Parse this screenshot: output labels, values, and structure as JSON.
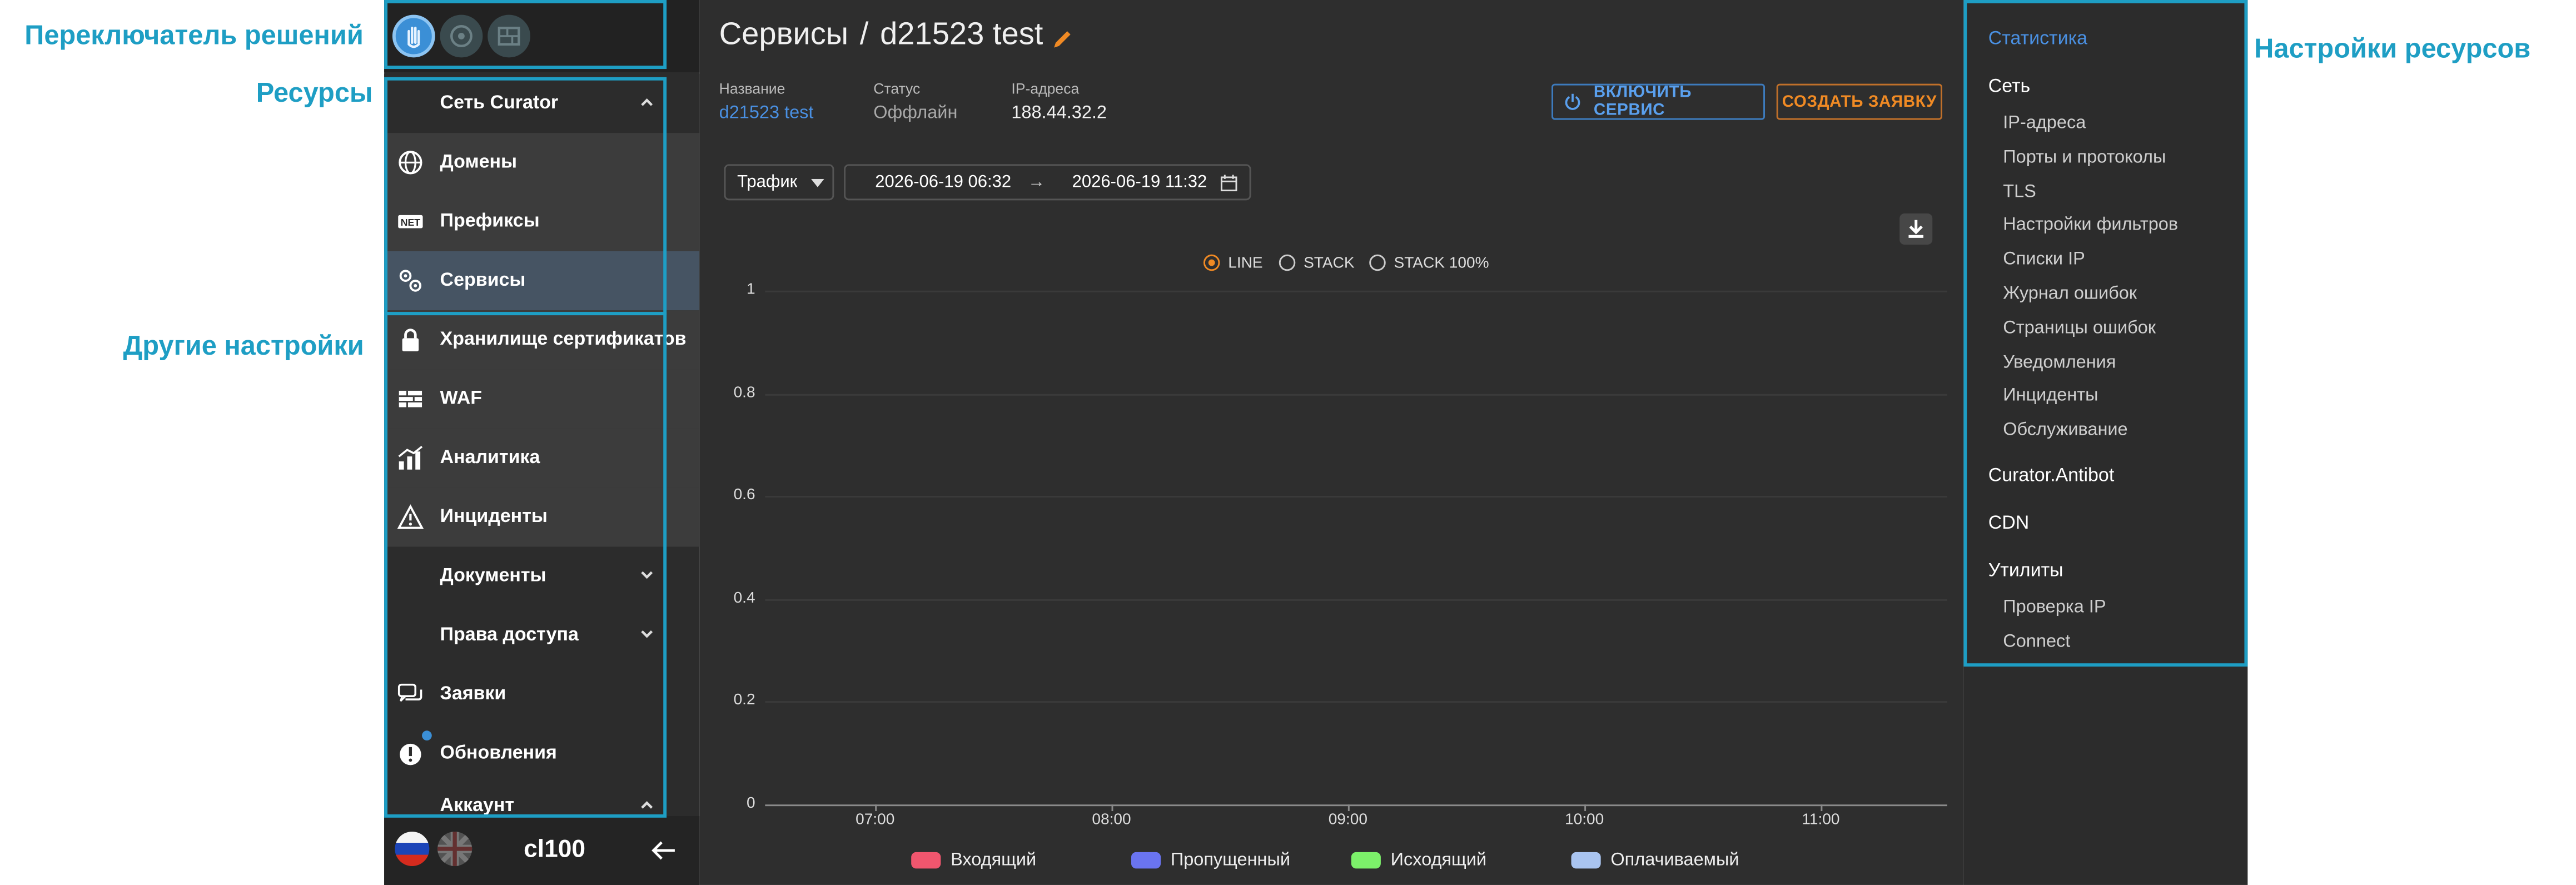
{
  "annotations": {
    "solution_switcher": "Переключатель решений",
    "resources": "Ресурсы",
    "other_settings": "Другие настройки",
    "resource_settings": "Настройки ресурсов"
  },
  "sidebar": {
    "group_network": "Сеть Curator",
    "items": [
      {
        "label": "Домены",
        "icon": "globe-icon"
      },
      {
        "label": "Префиксы",
        "icon": "net-icon"
      },
      {
        "label": "Сервисы",
        "icon": "gears-icon",
        "active": true
      },
      {
        "label": "Хранилище сертификатов",
        "icon": "lock-icon"
      },
      {
        "label": "WAF",
        "icon": "firewall-icon"
      },
      {
        "label": "Аналитика",
        "icon": "analytics-icon"
      },
      {
        "label": "Инциденты",
        "icon": "warning-icon"
      },
      {
        "label": "Документы",
        "icon": ""
      },
      {
        "label": "Права доступа",
        "icon": ""
      },
      {
        "label": "Заявки",
        "icon": "chat-icon"
      },
      {
        "label": "Обновления",
        "icon": "update-icon"
      },
      {
        "label": "Аккаунт",
        "icon": ""
      }
    ],
    "user": "cl100"
  },
  "header": {
    "section": "Сервисы",
    "separator": "/",
    "service_name": "d21523 test"
  },
  "info": {
    "name_label": "Название",
    "name_value": "d21523 test",
    "status_label": "Статус",
    "status_value": "Оффлайн",
    "ip_label": "IP-адреса",
    "ip_value": "188.44.32.2"
  },
  "actions": {
    "enable_service": "ВКЛЮЧИТЬ СЕРВИС",
    "create_request": "СОЗДАТЬ ЗАЯВКУ"
  },
  "filters": {
    "metric": "Трафик",
    "date_from": "2026-06-19 06:32",
    "arrow": "→",
    "date_to": "2026-06-19 11:32"
  },
  "chart_modes": [
    "LINE",
    "STACK",
    "STACK 100%"
  ],
  "chart_modes_selected": "LINE",
  "chart_data": {
    "type": "line",
    "x": [
      "07:00",
      "08:00",
      "09:00",
      "10:00",
      "11:00"
    ],
    "ylim": [
      0,
      1
    ],
    "yticks": [
      "1",
      "0.8",
      "0.6",
      "0.4",
      "0.2",
      "0"
    ],
    "series": [
      {
        "name": "Входящий",
        "color": "#f0566e",
        "values": []
      },
      {
        "name": "Пропущенный",
        "color": "#6a74f0",
        "values": []
      },
      {
        "name": "Исходящий",
        "color": "#7cf06a",
        "values": []
      },
      {
        "name": "Оплачиваемый",
        "color": "#a9c4f0",
        "values": []
      }
    ]
  },
  "right_panel": {
    "statistics": "Статистика",
    "network": "Сеть",
    "network_items": [
      "IP-адреса",
      "Порты и протоколы",
      "TLS",
      "Настройки фильтров",
      "Списки IP",
      "Журнал ошибок",
      "Страницы ошибок",
      "Уведомления",
      "Инциденты",
      "Обслуживание"
    ],
    "antibot": "Curator.Antibot",
    "cdn": "CDN",
    "utilities": "Утилиты",
    "utility_items": [
      "Проверка IP",
      "Connect"
    ]
  },
  "colors": {
    "accent_blue": "#4a90e2",
    "accent_orange": "#f08a24",
    "annotation": "#1e9ec4"
  }
}
